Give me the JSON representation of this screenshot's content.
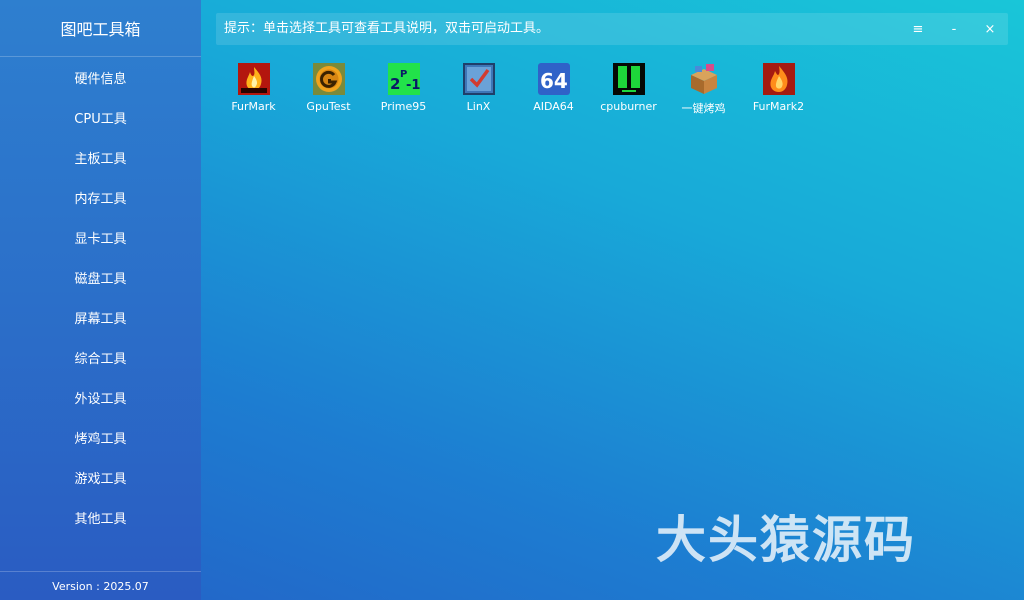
{
  "app": {
    "title": "图吧工具箱"
  },
  "sidebar": {
    "items": [
      {
        "label": "硬件信息"
      },
      {
        "label": "CPU工具"
      },
      {
        "label": "主板工具"
      },
      {
        "label": "内存工具"
      },
      {
        "label": "显卡工具"
      },
      {
        "label": "磁盘工具"
      },
      {
        "label": "屏幕工具"
      },
      {
        "label": "综合工具"
      },
      {
        "label": "外设工具"
      },
      {
        "label": "烤鸡工具"
      },
      {
        "label": "游戏工具"
      },
      {
        "label": "其他工具"
      }
    ],
    "version": "Version : 2025.07"
  },
  "topbar": {
    "hint": "提示：单击选择工具可查看工具说明，双击可启动工具。",
    "menu_glyph": "≡",
    "minimize_glyph": "-",
    "close_glyph": "×"
  },
  "tools": [
    {
      "label": "FurMark",
      "icon": "furmark-icon"
    },
    {
      "label": "GpuTest",
      "icon": "gputest-icon"
    },
    {
      "label": "Prime95",
      "icon": "prime95-icon"
    },
    {
      "label": "LinX",
      "icon": "linx-icon"
    },
    {
      "label": "AIDA64",
      "icon": "aida64-icon"
    },
    {
      "label": "cpuburner",
      "icon": "cpuburner-icon"
    },
    {
      "label": "一键烤鸡",
      "icon": "one-click-stress-icon"
    },
    {
      "label": "FurMark2",
      "icon": "furmark2-icon"
    }
  ],
  "watermark": "大头猿源码",
  "colors": {
    "sidebar_top": "#2e7fcf",
    "content_top_right": "#19c6d8",
    "content_bottom_left": "#2461c6"
  }
}
